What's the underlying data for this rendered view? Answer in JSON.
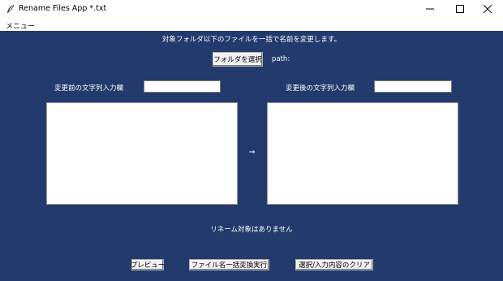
{
  "window": {
    "title": "Rename Files App *.txt",
    "icon": "feather-icon",
    "controls": [
      "minimize-icon",
      "maximize-icon",
      "close-icon"
    ]
  },
  "menubar": {
    "menu_label": "メニュー"
  },
  "main": {
    "background": "#233b6c",
    "description": "対象フォルダ以下のファイルを一括で名前を変更します。",
    "select_folder_button": "フォルダを選択",
    "path_label": "path:",
    "path_value": "",
    "before_label": "変更前の文字列入力欄",
    "before_value": "",
    "after_label": "変更後の文字列入力欄",
    "after_value": "",
    "arrow": "⇒",
    "status": "リネーム対象はありません",
    "buttons": {
      "preview": "プレビュー",
      "execute": "ファイル名一括変換実行",
      "clear": "選択/入力内容のクリア"
    }
  }
}
